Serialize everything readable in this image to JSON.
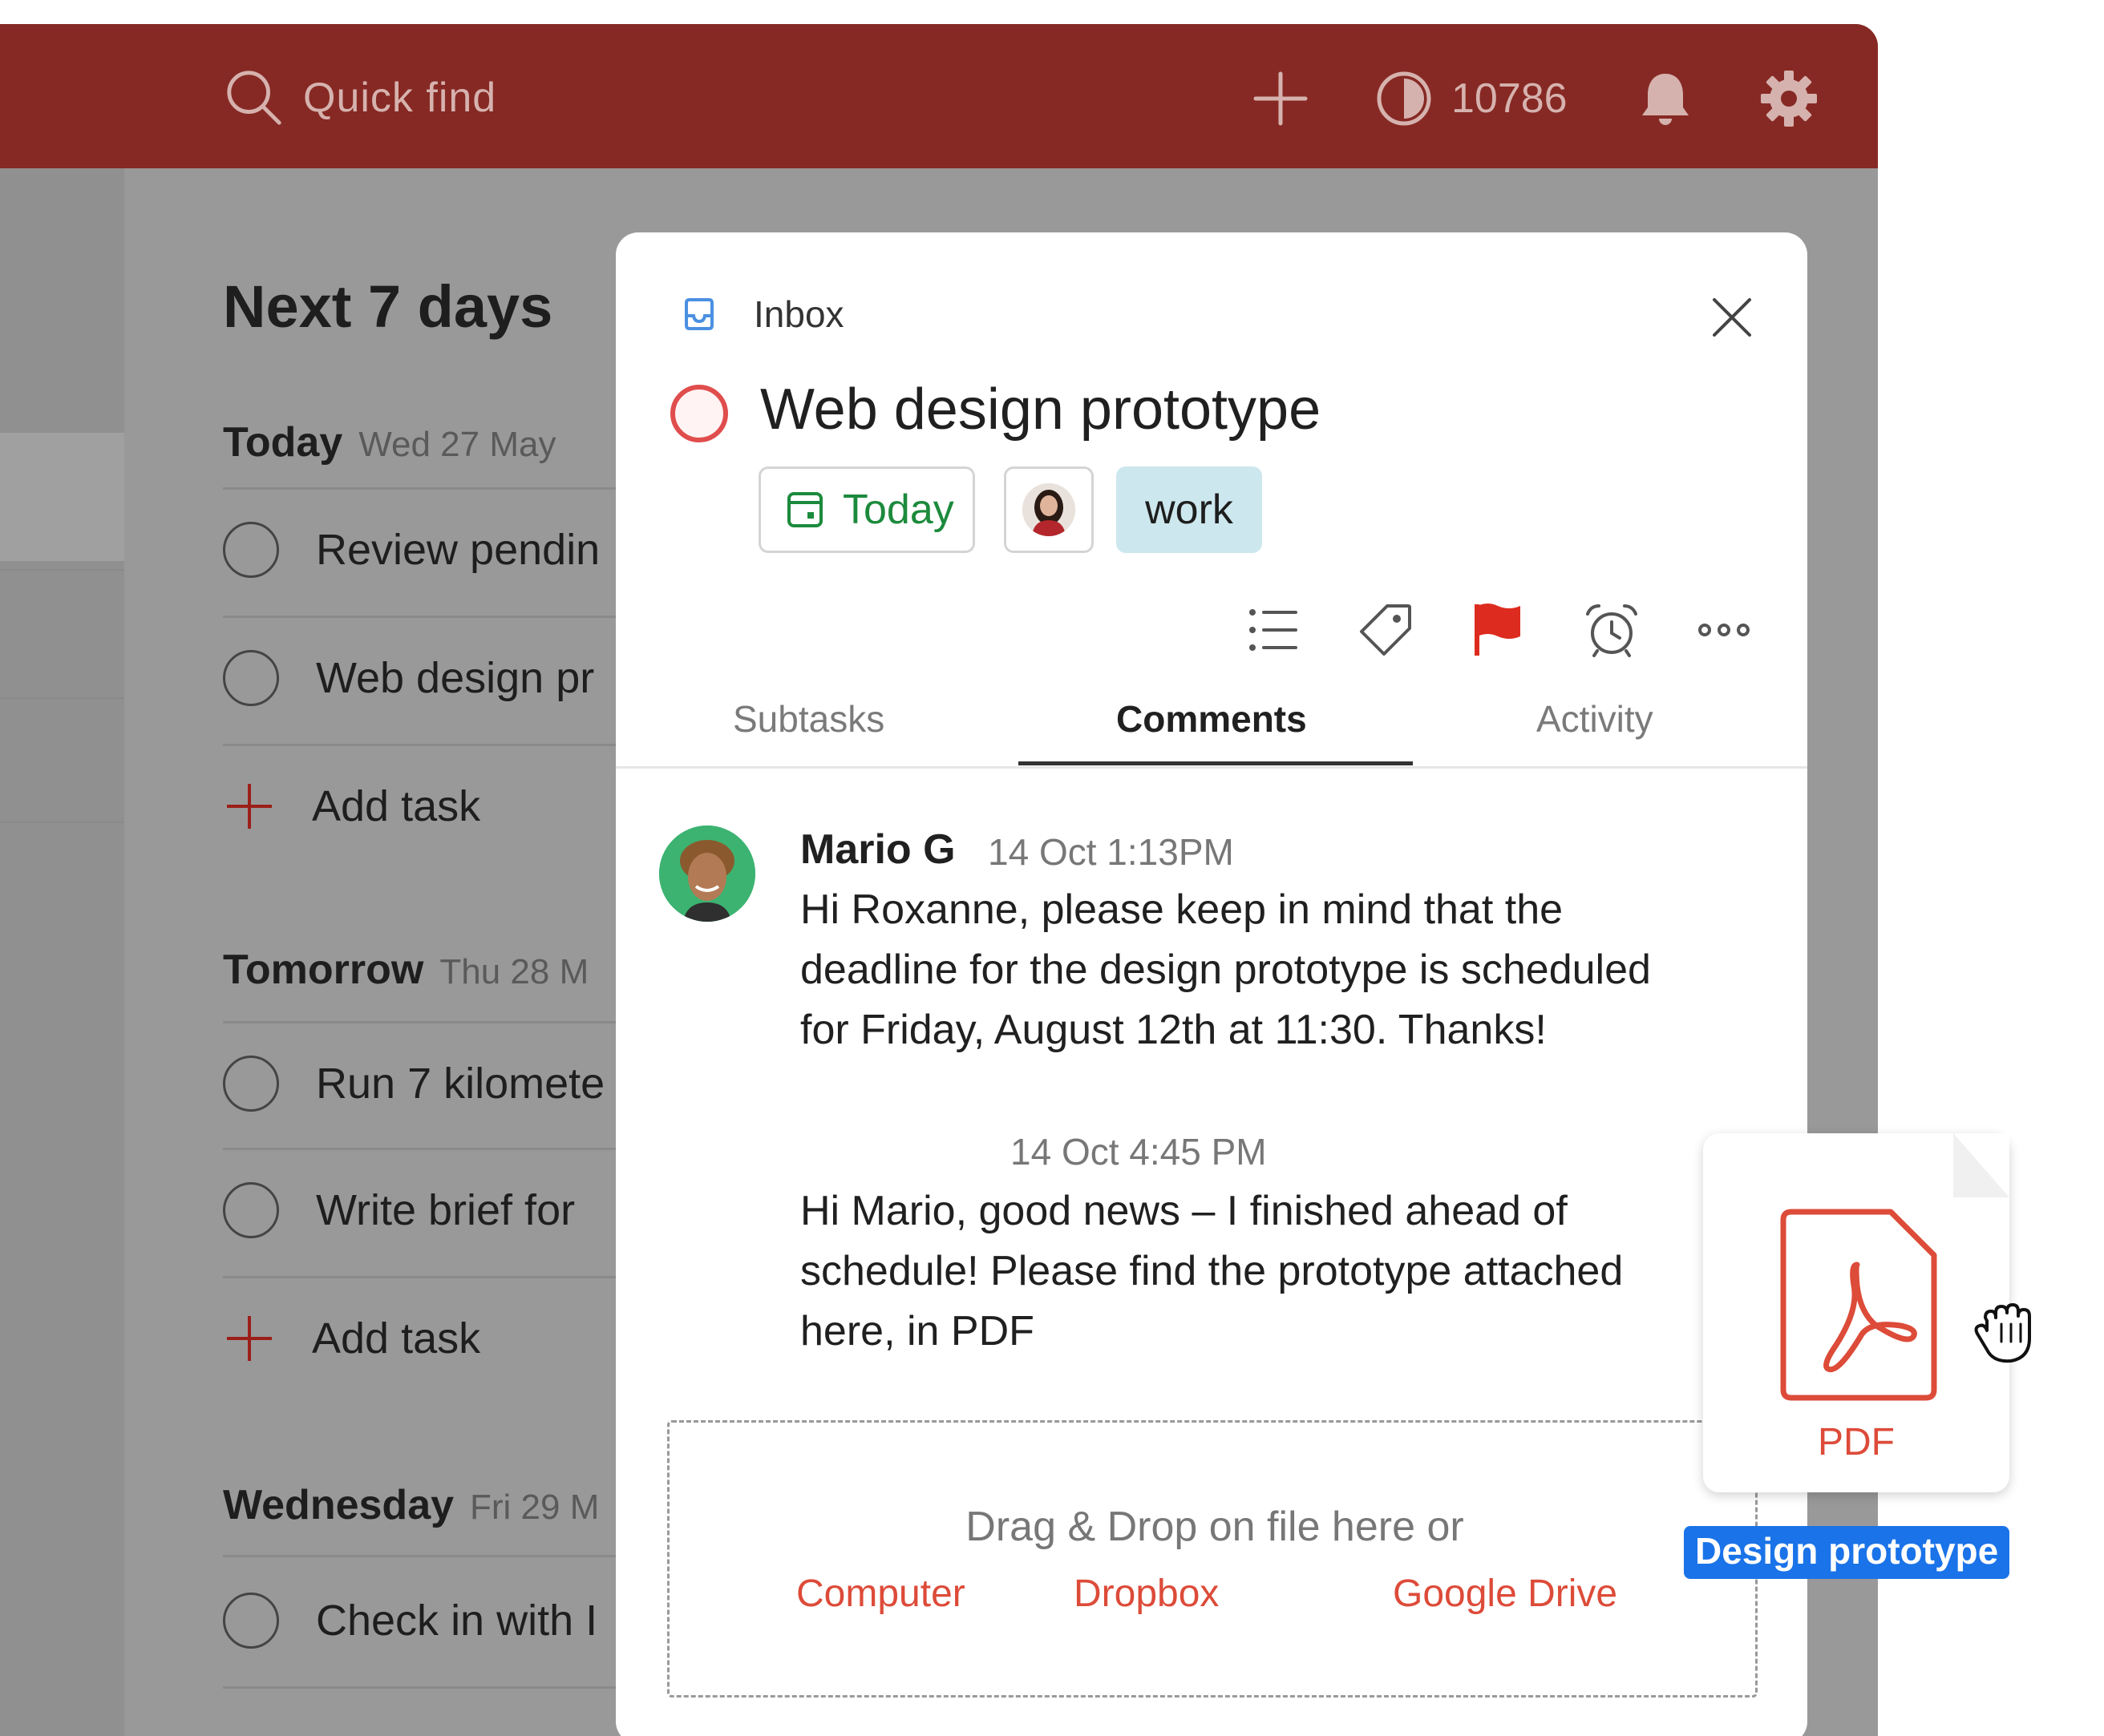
{
  "topbar": {
    "search_placeholder": "Quick find",
    "karma_points": "10786"
  },
  "list": {
    "title": "Next 7 days",
    "sections": [
      {
        "name": "Today",
        "date": "Wed 27 May",
        "tasks": [
          "Review pendin",
          "Web design pr"
        ],
        "add_label": "Add task"
      },
      {
        "name": "Tomorrow",
        "date": "Thu 28 M",
        "tasks": [
          "Run 7 kilomete",
          "Write brief for"
        ],
        "add_label": "Add task"
      },
      {
        "name": "Wednesday",
        "date": "Fri 29 M",
        "tasks": [
          "Check in with I"
        ]
      }
    ]
  },
  "modal": {
    "project": "Inbox",
    "task_title": "Web design prototype",
    "due_chip": "Today",
    "label_chip": "work",
    "tabs": [
      "Subtasks",
      "Comments",
      "Activity"
    ],
    "active_tab": "Comments",
    "comments": [
      {
        "author": "Mario G",
        "time": "14 Oct 1:13PM",
        "text": "Hi Roxanne, please keep in mind that the\ndeadline for the design prototype is scheduled\nfor Friday, August 12th at 11:30. Thanks!"
      },
      {
        "time": "14 Oct 4:45 PM",
        "text": "Hi Mario, good news – I finished ahead of\nschedule! Please find the prototype attached\nhere, in PDF"
      }
    ],
    "dropzone": {
      "title": "Drag & Drop on file here or",
      "links": [
        "Computer",
        "Dropbox",
        "Google Drive"
      ]
    }
  },
  "drag_file": {
    "type": "PDF",
    "name": "Design prototype"
  },
  "colors": {
    "topbar": "#862924",
    "accent_red": "#dd4b39",
    "priority_flag": "#dd2c1f",
    "date_green": "#1c8a3c",
    "label_bg": "#cde7ee",
    "selection_blue": "#1a73e8"
  }
}
